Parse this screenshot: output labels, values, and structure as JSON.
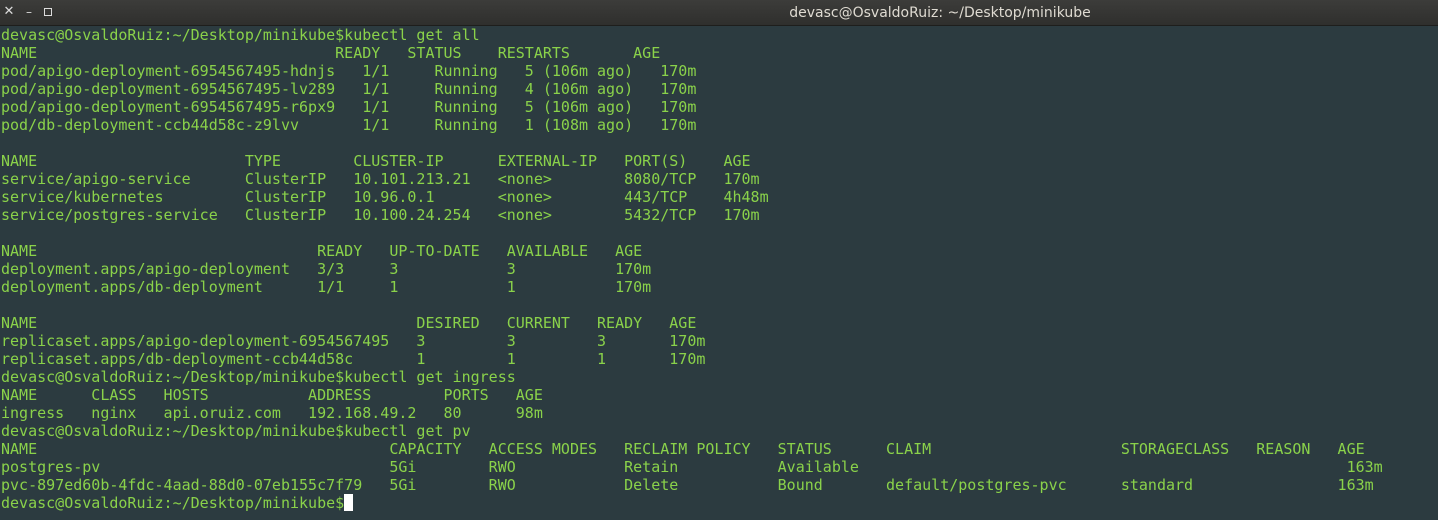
{
  "window": {
    "title": "devasc@OsvaldoRuiz: ~/Desktop/minikube",
    "close_icon": "close-icon",
    "minimize_icon": "minimize-icon",
    "maximize_icon": "maximize-icon"
  },
  "terminal": {
    "lines": [
      "devasc@OsvaldoRuiz:~/Desktop/minikube$kubectl get all",
      "NAME                                 READY   STATUS    RESTARTS       AGE",
      "pod/apigo-deployment-6954567495-hdnjs   1/1     Running   5 (106m ago)   170m",
      "pod/apigo-deployment-6954567495-lv289   1/1     Running   4 (106m ago)   170m",
      "pod/apigo-deployment-6954567495-r6px9   1/1     Running   5 (106m ago)   170m",
      "pod/db-deployment-ccb44d58c-z9lvv       1/1     Running   1 (108m ago)   170m",
      "",
      "NAME                       TYPE        CLUSTER-IP      EXTERNAL-IP   PORT(S)    AGE",
      "service/apigo-service      ClusterIP   10.101.213.21   <none>        8080/TCP   170m",
      "service/kubernetes         ClusterIP   10.96.0.1       <none>        443/TCP    4h48m",
      "service/postgres-service   ClusterIP   10.100.24.254   <none>        5432/TCP   170m",
      "",
      "NAME                               READY   UP-TO-DATE   AVAILABLE   AGE",
      "deployment.apps/apigo-deployment   3/3     3            3           170m",
      "deployment.apps/db-deployment      1/1     1            1           170m",
      "",
      "NAME                                          DESIRED   CURRENT   READY   AGE",
      "replicaset.apps/apigo-deployment-6954567495   3         3         3       170m",
      "replicaset.apps/db-deployment-ccb44d58c       1         1         1       170m",
      "devasc@OsvaldoRuiz:~/Desktop/minikube$kubectl get ingress",
      "NAME      CLASS   HOSTS           ADDRESS        PORTS   AGE",
      "ingress   nginx   api.oruiz.com   192.168.49.2   80      98m",
      "devasc@OsvaldoRuiz:~/Desktop/minikube$kubectl get pv",
      "NAME                                       CAPACITY   ACCESS MODES   RECLAIM POLICY   STATUS      CLAIM                     STORAGECLASS   REASON   AGE",
      "postgres-pv                                5Gi        RWO            Retain           Available                                                      163m",
      "pvc-897ed60b-4fdc-4aad-88d0-07eb155c7f79   5Gi        RWO            Delete           Bound       default/postgres-pvc      standard                163m"
    ],
    "prompt": "devasc@OsvaldoRuiz:~/Desktop/minikube$",
    "text_color": "#8ad24a",
    "background_color": "#2c3b40",
    "cursor_color": "#ffffff"
  }
}
